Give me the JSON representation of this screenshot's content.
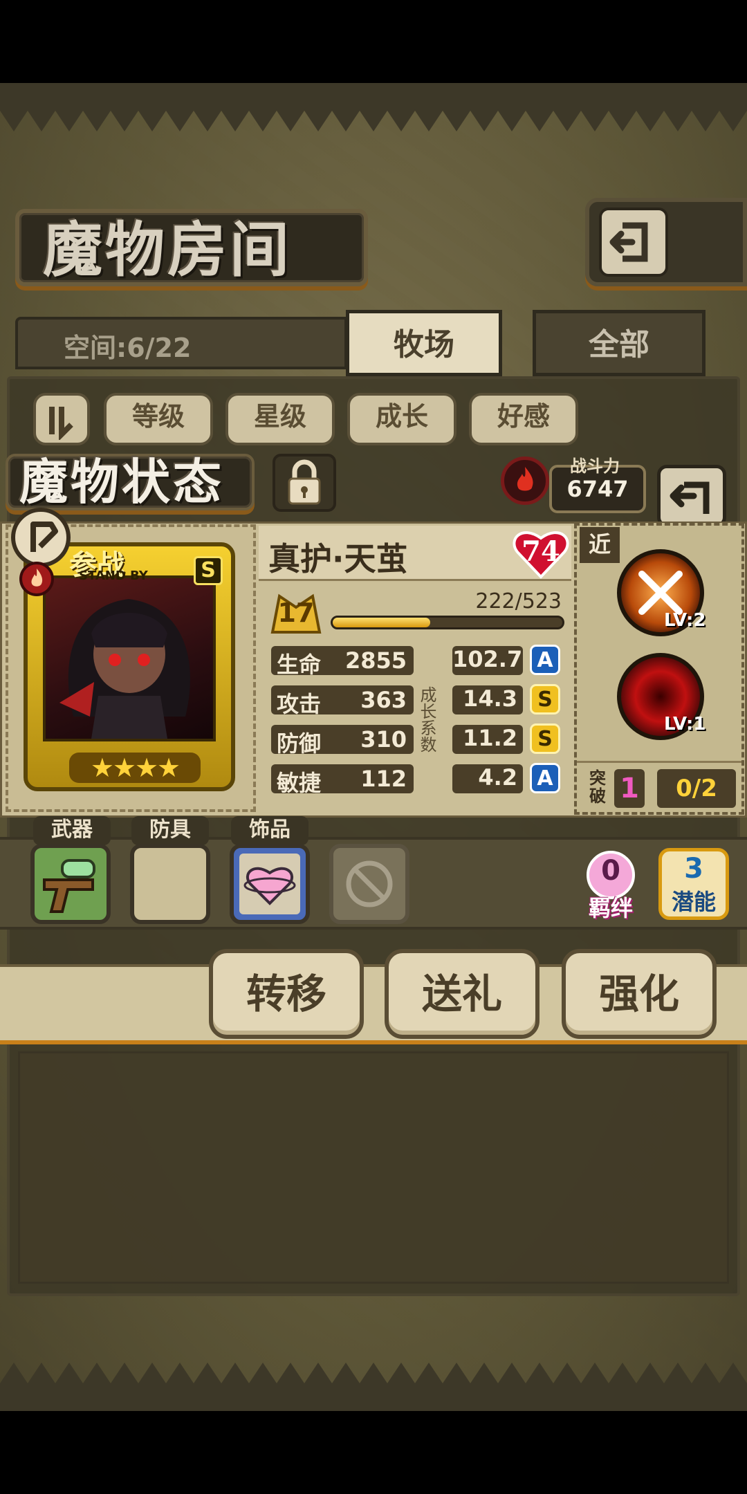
{
  "header": {
    "title": "魔物房间",
    "back_icon": "return-arrow-icon"
  },
  "tabs": {
    "space_label": "空间:6/22",
    "items": [
      {
        "label": "牧场",
        "active": true
      },
      {
        "label": "全部",
        "active": false
      }
    ]
  },
  "sort": {
    "toggle_icon": "sort-toggle-icon",
    "buttons": [
      "等级",
      "星级",
      "成长",
      "好感"
    ]
  },
  "status": {
    "title": "魔物状态",
    "lock_icon": "padlock-icon",
    "combat_label": "战斗力",
    "combat_power": "6747",
    "element_icon": "fire-element-icon"
  },
  "monster": {
    "name": "真护·天茧",
    "affection": "74",
    "level": "17",
    "exp": "222/523",
    "exp_fraction": 0.424,
    "standby_cn": "参战",
    "standby_en": "STAND BY",
    "rank": "S",
    "stars": 4,
    "growth_label": "成长系数"
  },
  "stats": [
    {
      "label": "生命",
      "value": "2855",
      "growth": "102.7",
      "grade": "A"
    },
    {
      "label": "攻击",
      "value": "363",
      "growth": "14.3",
      "grade": "S"
    },
    {
      "label": "防御",
      "value": "310",
      "growth": "11.2",
      "grade": "S"
    },
    {
      "label": "敏捷",
      "value": "112",
      "growth": "4.2",
      "grade": "A"
    }
  ],
  "skills": {
    "type_label": "近",
    "items": [
      {
        "level": "LV:2",
        "icon": "slash-burst-icon"
      },
      {
        "level": "LV:1",
        "icon": "dark-vortex-icon"
      }
    ],
    "breakthrough_label": "突破",
    "breakthrough_value": "1",
    "breakthrough_progress": "0/2"
  },
  "equipment": {
    "slots": [
      {
        "label": "武器",
        "icon": "water-gun-icon"
      },
      {
        "label": "防具",
        "icon": "empty-slot"
      },
      {
        "label": "饰品",
        "icon": "heart-charm-icon"
      },
      {
        "label": "",
        "icon": "disabled-slot-icon"
      }
    ],
    "bond_value": "0",
    "bond_label": "羁绊",
    "potential_value": "3",
    "potential_label": "潜能"
  },
  "actions": [
    "转移",
    "送礼",
    "强化"
  ]
}
